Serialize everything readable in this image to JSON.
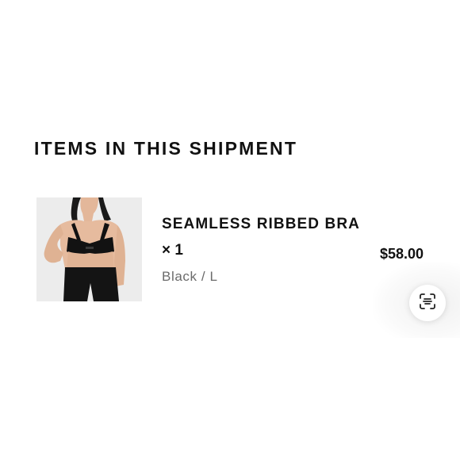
{
  "section": {
    "title": "ITEMS IN THIS SHIPMENT"
  },
  "item": {
    "name": "SEAMLESS RIBBED BRA",
    "quantity": "× 1",
    "variant": "Black / L",
    "price": "$58.00",
    "image_icon": "product-photo"
  },
  "scan_button": {
    "icon": "scan-text-icon"
  }
}
